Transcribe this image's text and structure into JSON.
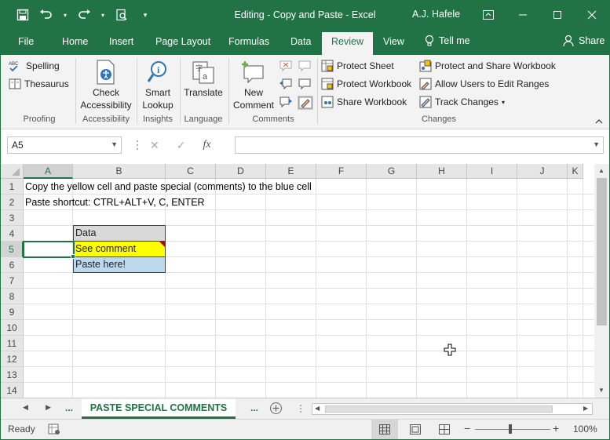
{
  "titlebar": {
    "title": "Editing - Copy and Paste  -  Excel",
    "user": "A.J. Hafele",
    "quick_access": [
      "save-icon",
      "undo-icon",
      "redo-icon",
      "print-preview-icon",
      "customize-qat-icon"
    ],
    "window_controls": [
      "ribbon-display-icon",
      "minimize-icon",
      "maximize-icon",
      "close-icon"
    ]
  },
  "tabs": {
    "items": [
      "File",
      "Home",
      "Insert",
      "Page Layout",
      "Formulas",
      "Data",
      "Review",
      "View",
      "Tell me",
      "Share"
    ],
    "active": "Review"
  },
  "ribbon": {
    "proofing": {
      "label": "Proofing",
      "spelling": "Spelling",
      "thesaurus": "Thesaurus"
    },
    "accessibility": {
      "label": "Accessibility",
      "check_line1": "Check",
      "check_line2": "Accessibility"
    },
    "insights": {
      "label": "Insights",
      "line1": "Smart",
      "line2": "Lookup"
    },
    "language": {
      "label": "Language",
      "translate": "Translate"
    },
    "comments": {
      "label": "Comments",
      "line1": "New",
      "line2": "Comment"
    },
    "changes": {
      "label": "Changes",
      "protect_sheet": "Protect Sheet",
      "protect_workbook": "Protect Workbook",
      "share_workbook": "Share Workbook",
      "protect_share": "Protect and Share Workbook",
      "allow_users": "Allow Users to Edit Ranges",
      "track_changes": "Track Changes"
    }
  },
  "formula_bar": {
    "name_box": "A5",
    "cancel": "✕",
    "enter": "✓",
    "fx": "fx",
    "formula": ""
  },
  "columns": [
    "A",
    "B",
    "C",
    "D",
    "E",
    "F",
    "G",
    "H",
    "I",
    "J",
    "K"
  ],
  "rows": [
    "1",
    "2",
    "3",
    "4",
    "5",
    "6",
    "7",
    "8",
    "9",
    "10",
    "11",
    "12",
    "13",
    "14"
  ],
  "selected": {
    "column": "A",
    "row": "5"
  },
  "cells": {
    "a1": "Copy the yellow cell and paste special (comments) to the blue cell",
    "a2": "Paste shortcut: CTRL+ALT+V, C, ENTER",
    "b4": "Data",
    "b5": "See comment",
    "b6": "Paste here!"
  },
  "colors": {
    "excel_green": "#217346",
    "yellow_cell": "#ffff00",
    "blue_cell": "#bdd7ee",
    "header_cell": "#d9d9d9",
    "comment_indicator": "#c00000"
  },
  "sheet_tabs": {
    "prev_dots": "...",
    "active": "PASTE SPECIAL COMMENTS",
    "next_dots": "..."
  },
  "status": {
    "mode": "Ready",
    "zoom": "100%"
  }
}
